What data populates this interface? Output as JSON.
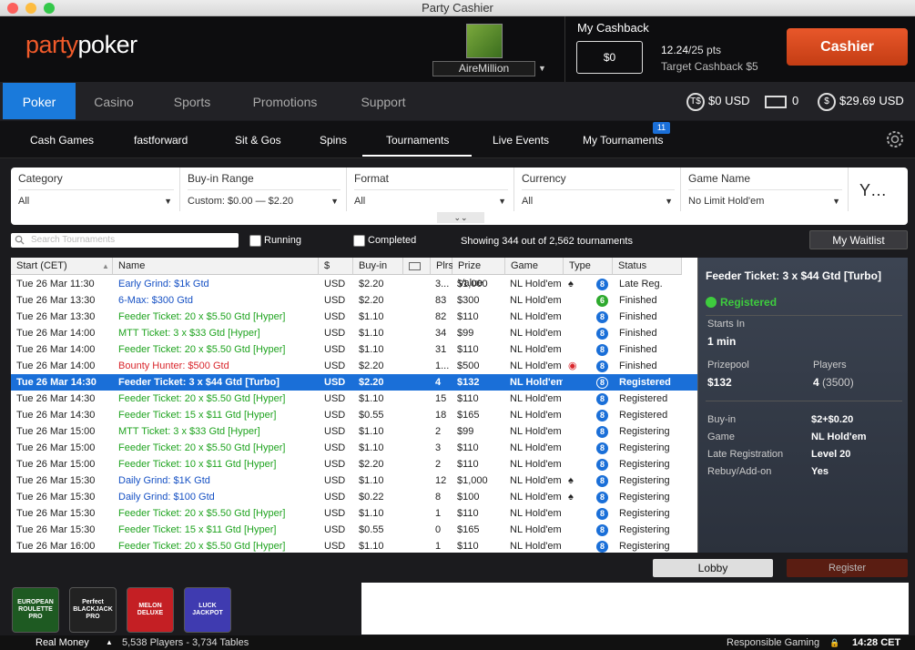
{
  "window": {
    "title": "Party Cashier"
  },
  "brand": {
    "logo_part1": "party",
    "logo_part2": "poker",
    "accent": "#f05a2a"
  },
  "user": {
    "name": "AireMillion"
  },
  "cashback": {
    "title": "My Cashback",
    "value": "$0",
    "points_current": "12.24",
    "points_total": "/25 pts",
    "target": "Target Cashback $5"
  },
  "cashier_label": "Cashier",
  "main_tabs": [
    "Poker",
    "Casino",
    "Sports",
    "Promotions",
    "Support"
  ],
  "balances": {
    "tdollar": "$0 USD",
    "tickets": "0",
    "cash": "$29.69 USD",
    "tdollar_icon": "T$",
    "cash_icon": "$"
  },
  "sub_tabs": [
    "Cash Games",
    "fastforward",
    "Sit & Gos",
    "Spins",
    "Tournaments",
    "Live Events",
    "My Tournaments"
  ],
  "my_tournaments_badge": "11",
  "filters": [
    {
      "label": "Category",
      "value": "All"
    },
    {
      "label": "Buy-in Range",
      "value": "Custom: $0.00 — $2.20"
    },
    {
      "label": "Format",
      "value": "All"
    },
    {
      "label": "Currency",
      "value": "All"
    },
    {
      "label": "Game Name",
      "value": "No Limit Hold'em"
    }
  ],
  "filter_icon": "Y…",
  "search_placeholder": "Search Tournaments",
  "running_label": "Running",
  "completed_label": "Completed",
  "showing": "Showing 344 out of 2,562 tournaments",
  "waitlist_label": "My Waitlist",
  "columns": [
    "Start (CET)",
    "Name",
    "$",
    "Buy-in",
    "",
    "Plrs",
    "Prize Value",
    "Game",
    "Type",
    "Status"
  ],
  "rows": [
    {
      "start": "Tue 26 Mar 11:30",
      "name": "Early Grind: $1k Gtd",
      "color": "blue",
      "cur": "USD",
      "buyin": "$2.20",
      "plrs": "3...",
      "prize": "$1,000",
      "game": "NL Hold'em",
      "extra": "♠",
      "badge": "8",
      "status": "Late Reg."
    },
    {
      "start": "Tue 26 Mar 13:30",
      "name": "6-Max: $300 Gtd",
      "color": "blue",
      "cur": "USD",
      "buyin": "$2.20",
      "plrs": "83",
      "prize": "$300",
      "game": "NL Hold'em",
      "extra": "",
      "badge": "6",
      "status": "Finished"
    },
    {
      "start": "Tue 26 Mar 13:30",
      "name": "Feeder Ticket: 20 x $5.50 Gtd [Hyper]",
      "color": "green",
      "cur": "USD",
      "buyin": "$1.10",
      "plrs": "82",
      "prize": "$110",
      "game": "NL Hold'em",
      "extra": "",
      "badge": "8",
      "status": "Finished"
    },
    {
      "start": "Tue 26 Mar 14:00",
      "name": "MTT Ticket: 3 x $33 Gtd [Hyper]",
      "color": "green",
      "cur": "USD",
      "buyin": "$1.10",
      "plrs": "34",
      "prize": "$99",
      "game": "NL Hold'em",
      "extra": "",
      "badge": "8",
      "status": "Finished"
    },
    {
      "start": "Tue 26 Mar 14:00",
      "name": "Feeder Ticket: 20 x $5.50 Gtd [Hyper]",
      "color": "green",
      "cur": "USD",
      "buyin": "$1.10",
      "plrs": "31",
      "prize": "$110",
      "game": "NL Hold'em",
      "extra": "",
      "badge": "8",
      "status": "Finished"
    },
    {
      "start": "Tue 26 Mar 14:00",
      "name": "Bounty Hunter: $500 Gtd",
      "color": "red",
      "cur": "USD",
      "buyin": "$2.20",
      "plrs": "1...",
      "prize": "$500",
      "game": "NL Hold'em",
      "extra": "◉",
      "badge": "8",
      "status": "Finished"
    },
    {
      "start": "Tue 26 Mar 14:30",
      "name": "Feeder Ticket: 3 x $44 Gtd [Turbo]",
      "color": "blue",
      "cur": "USD",
      "buyin": "$2.20",
      "plrs": "4",
      "prize": "$132",
      "game": "NL Hold'em",
      "extra": "",
      "badge": "8",
      "status": "Registered",
      "selected": true
    },
    {
      "start": "Tue 26 Mar 14:30",
      "name": "Feeder Ticket: 20 x $5.50 Gtd [Hyper]",
      "color": "green",
      "cur": "USD",
      "buyin": "$1.10",
      "plrs": "15",
      "prize": "$110",
      "game": "NL Hold'em",
      "extra": "",
      "badge": "8",
      "status": "Registered"
    },
    {
      "start": "Tue 26 Mar 14:30",
      "name": "Feeder Ticket: 15 x $11 Gtd [Hyper]",
      "color": "green",
      "cur": "USD",
      "buyin": "$0.55",
      "plrs": "18",
      "prize": "$165",
      "game": "NL Hold'em",
      "extra": "",
      "badge": "8",
      "status": "Registered"
    },
    {
      "start": "Tue 26 Mar 15:00",
      "name": "MTT Ticket: 3 x $33 Gtd [Hyper]",
      "color": "green",
      "cur": "USD",
      "buyin": "$1.10",
      "plrs": "2",
      "prize": "$99",
      "game": "NL Hold'em",
      "extra": "",
      "badge": "8",
      "status": "Registering"
    },
    {
      "start": "Tue 26 Mar 15:00",
      "name": "Feeder Ticket: 20 x $5.50 Gtd [Hyper]",
      "color": "green",
      "cur": "USD",
      "buyin": "$1.10",
      "plrs": "3",
      "prize": "$110",
      "game": "NL Hold'em",
      "extra": "",
      "badge": "8",
      "status": "Registering"
    },
    {
      "start": "Tue 26 Mar 15:00",
      "name": "Feeder Ticket: 10 x $11 Gtd [Hyper]",
      "color": "green",
      "cur": "USD",
      "buyin": "$2.20",
      "plrs": "2",
      "prize": "$110",
      "game": "NL Hold'em",
      "extra": "",
      "badge": "8",
      "status": "Registering"
    },
    {
      "start": "Tue 26 Mar 15:30",
      "name": "Daily Grind: $1K Gtd",
      "color": "blue",
      "cur": "USD",
      "buyin": "$1.10",
      "plrs": "12",
      "prize": "$1,000",
      "game": "NL Hold'em",
      "extra": "♠",
      "badge": "8",
      "status": "Registering"
    },
    {
      "start": "Tue 26 Mar 15:30",
      "name": "Daily Grind: $100 Gtd",
      "color": "blue",
      "cur": "USD",
      "buyin": "$0.22",
      "plrs": "8",
      "prize": "$100",
      "game": "NL Hold'em",
      "extra": "♠",
      "badge": "8",
      "status": "Registering"
    },
    {
      "start": "Tue 26 Mar 15:30",
      "name": "Feeder Ticket: 20 x $5.50 Gtd [Hyper]",
      "color": "green",
      "cur": "USD",
      "buyin": "$1.10",
      "plrs": "1",
      "prize": "$110",
      "game": "NL Hold'em",
      "extra": "",
      "badge": "8",
      "status": "Registering"
    },
    {
      "start": "Tue 26 Mar 15:30",
      "name": "Feeder Ticket: 15 x $11 Gtd [Hyper]",
      "color": "green",
      "cur": "USD",
      "buyin": "$0.55",
      "plrs": "0",
      "prize": "$165",
      "game": "NL Hold'em",
      "extra": "",
      "badge": "8",
      "status": "Registering"
    },
    {
      "start": "Tue 26 Mar 16:00",
      "name": "Feeder Ticket: 20 x $5.50 Gtd [Hyper]",
      "color": "green",
      "cur": "USD",
      "buyin": "$1.10",
      "plrs": "1",
      "prize": "$110",
      "game": "NL Hold'em",
      "extra": "",
      "badge": "8",
      "status": "Registering"
    }
  ],
  "panel": {
    "title": "Feeder Ticket: 3 x $44 Gtd [Turbo]",
    "status": "Registered",
    "starts_in_label": "Starts In",
    "starts_in": "1 min",
    "prizepool_label": "Prizepool",
    "prizepool": "$132",
    "players_label": "Players",
    "players": "4",
    "players_max": "(3500)",
    "buyin_label": "Buy-in",
    "buyin": "$2+$0.20",
    "game_label": "Game",
    "game": "NL Hold'em",
    "late_label": "Late Registration",
    "late": "Level 20",
    "rebuy_label": "Rebuy/Add-on",
    "rebuy": "Yes"
  },
  "lobby_label": "Lobby",
  "register_label": "Register",
  "games": [
    {
      "text": "EUROPEAN ROULETTE PRO",
      "bg": "#1e5a22"
    },
    {
      "text": "Perfect BLACKJACK PRO",
      "bg": "#222222"
    },
    {
      "text": "MELON DELUXE",
      "bg": "#c41f24"
    },
    {
      "text": "LUCK JACKPOT",
      "bg": "#3f3bb0"
    }
  ],
  "footer": {
    "mode": "Real Money",
    "stats": "5,538 Players - 3,734 Tables",
    "responsible": "Responsible Gaming",
    "time": "14:28 CET"
  }
}
